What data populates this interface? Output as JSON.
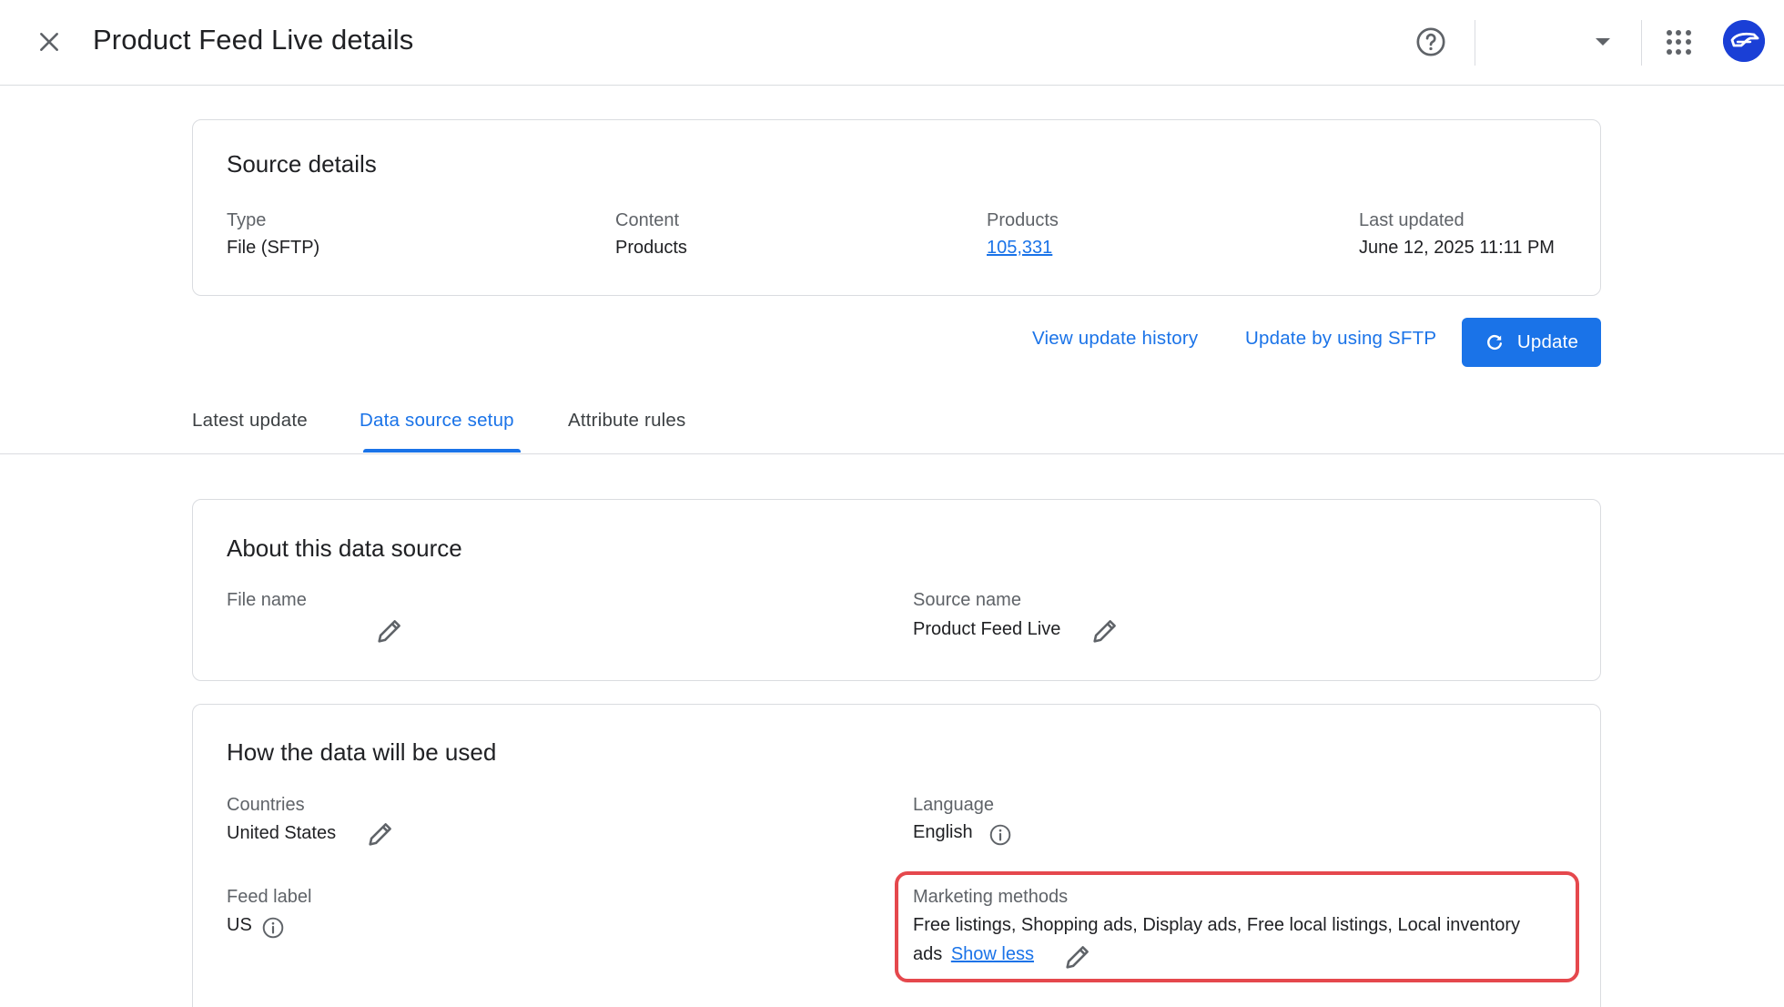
{
  "header": {
    "title": "Product Feed Live details",
    "close_icon": "close-icon",
    "help_icon": "help-icon",
    "account_selector_value": "",
    "apps_icon": "apps-grid-icon",
    "avatar_icon": "account-avatar-icon"
  },
  "source_details": {
    "title": "Source details",
    "type_label": "Type",
    "type_value": "File (SFTP)",
    "content_label": "Content",
    "content_value": "Products",
    "products_label": "Products",
    "products_value": "105,331",
    "last_updated_label": "Last updated",
    "last_updated_value": "June 12, 2025 11:11 PM"
  },
  "actions": {
    "view_history": "View update history",
    "update_sftp": "Update by using SFTP",
    "update": "Update",
    "update_icon": "refresh-icon"
  },
  "tabs": [
    {
      "label": "Latest update",
      "active": false
    },
    {
      "label": "Data source setup",
      "active": true
    },
    {
      "label": "Attribute rules",
      "active": false
    }
  ],
  "about": {
    "title": "About this data source",
    "file_name_label": "File name",
    "file_name_value": "",
    "source_name_label": "Source name",
    "source_name_value": "Product Feed Live"
  },
  "usage": {
    "title": "How the data will be used",
    "countries_label": "Countries",
    "countries_value": "United States",
    "language_label": "Language",
    "language_value": "English",
    "feed_label_label": "Feed label",
    "feed_label_value": "US",
    "marketing_label": "Marketing methods",
    "marketing_value_line1": "Free listings, Shopping ads, Display ads, Free local listings, Local inventory",
    "marketing_value_line2": "ads",
    "show_less": "Show less"
  },
  "colors": {
    "primary": "#1a73e8",
    "highlight": "#e5484d",
    "avatar": "#1a3fd6"
  }
}
